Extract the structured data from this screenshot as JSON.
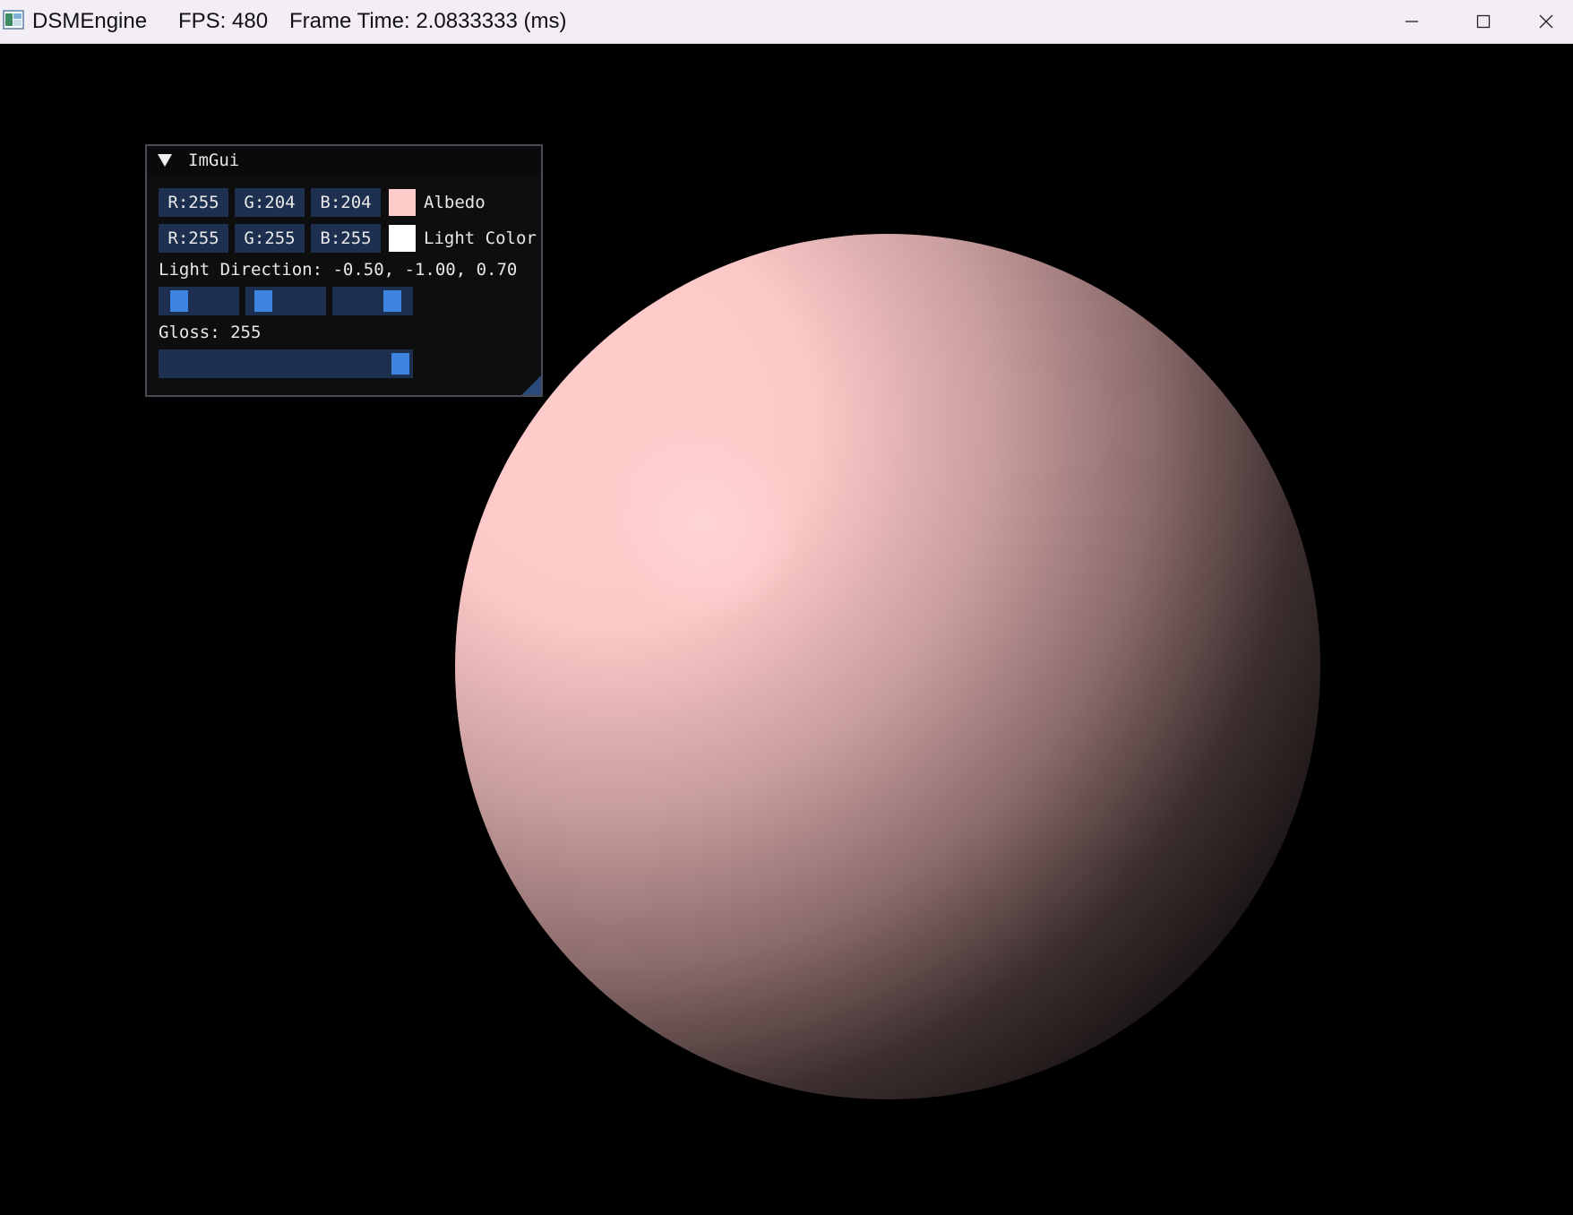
{
  "titlebar": {
    "app_name": "DSMEngine",
    "fps": "FPS: 480",
    "frame_time": "Frame Time: 2.0833333 (ms)",
    "icons": [
      "app-icon",
      "minimize-icon",
      "maximize-icon",
      "close-icon"
    ]
  },
  "imgui": {
    "title": "ImGui",
    "albedo": {
      "r": "R:255",
      "g": "G:204",
      "b": "B:204",
      "label": "Albedo",
      "color": "#ffcccc"
    },
    "light_color": {
      "r": "R:255",
      "g": "G:255",
      "b": "B:255",
      "label": "Light Color",
      "color": "#ffffff"
    },
    "light_direction": {
      "label": "Light Direction: -0.50, -1.00, 0.70",
      "x": -0.5,
      "y": -1.0,
      "z": 0.7
    },
    "gloss": {
      "label": "Gloss: 255",
      "value": 255,
      "max": 255
    }
  },
  "scene": {
    "object": "sphere",
    "base_color": "#ffcccc",
    "background": "#000000"
  }
}
